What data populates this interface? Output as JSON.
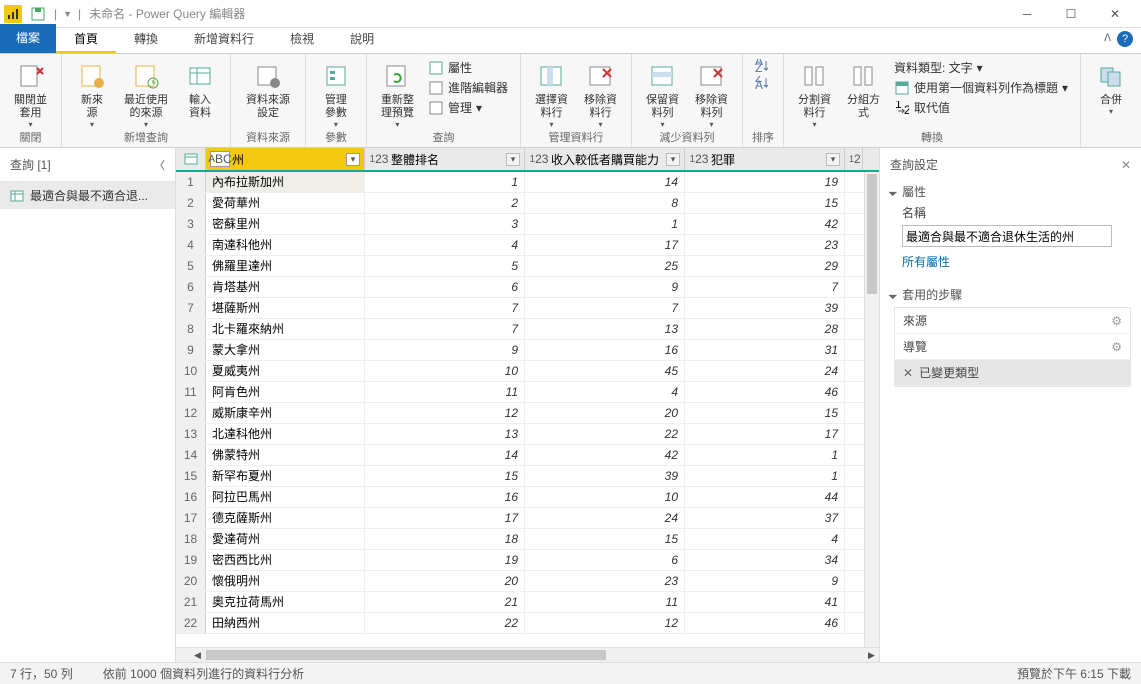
{
  "window": {
    "title": "未命名 - Power Query 編輯器"
  },
  "tabs": {
    "file": "檔案",
    "home": "首頁",
    "transform": "轉換",
    "addcol": "新增資料行",
    "view": "檢視",
    "help": "說明"
  },
  "ribbon": {
    "close": {
      "close_apply": "關閉並\n套用",
      "group": "關閉"
    },
    "newquery": {
      "new_source": "新來\n源",
      "recent": "最近使用\n的來源",
      "enter": "輸入\n資料",
      "group": "新增查詢"
    },
    "datasource": {
      "settings": "資料來源設定",
      "group": "資料來源"
    },
    "params": {
      "manage": "管理參數",
      "group": "參數"
    },
    "query": {
      "refresh": "重新整\n理預覽",
      "properties": "屬性",
      "adv_editor": "進階編輯器",
      "manage": "管理",
      "group": "查詢"
    },
    "cols": {
      "choose": "選擇資\n料行",
      "remove": "移除資\n料行",
      "group": "管理資料行"
    },
    "rows": {
      "keep": "保留資\n料列",
      "remove": "移除資\n料列",
      "group": "減少資料列"
    },
    "sort": {
      "group": "排序"
    },
    "split": {
      "split": "分割資\n料行",
      "groupby": "分組方\n式"
    },
    "transform": {
      "datatype": "資料類型: 文字",
      "first_row": "使用第一個資料列作為標題",
      "replace": "取代值",
      "group": "轉換"
    },
    "combine": {
      "combine": "合併",
      "group": ""
    }
  },
  "queries": {
    "header": "查詢 [1]",
    "items": [
      "最適合與最不適合退..."
    ]
  },
  "columns": [
    "州",
    "整體排名",
    "收入較低者購買能力",
    "犯罪"
  ],
  "rows": [
    {
      "n": 1,
      "state": "內布拉斯加州",
      "v": [
        1,
        14,
        19
      ]
    },
    {
      "n": 2,
      "state": "愛荷華州",
      "v": [
        2,
        8,
        15
      ]
    },
    {
      "n": 3,
      "state": "密蘇里州",
      "v": [
        3,
        1,
        42
      ]
    },
    {
      "n": 4,
      "state": "南達科他州",
      "v": [
        4,
        17,
        23
      ]
    },
    {
      "n": 5,
      "state": "佛羅里達州",
      "v": [
        5,
        25,
        29
      ]
    },
    {
      "n": 6,
      "state": "肯塔基州",
      "v": [
        6,
        9,
        7
      ]
    },
    {
      "n": 7,
      "state": "堪薩斯州",
      "v": [
        7,
        7,
        39
      ]
    },
    {
      "n": 8,
      "state": "北卡羅來納州",
      "v": [
        7,
        13,
        28
      ]
    },
    {
      "n": 9,
      "state": "蒙大拿州",
      "v": [
        9,
        16,
        31
      ]
    },
    {
      "n": 10,
      "state": "夏威夷州",
      "v": [
        10,
        45,
        24
      ]
    },
    {
      "n": 11,
      "state": "阿肯色州",
      "v": [
        11,
        4,
        46
      ]
    },
    {
      "n": 12,
      "state": "威斯康辛州",
      "v": [
        12,
        20,
        15
      ]
    },
    {
      "n": 13,
      "state": "北達科他州",
      "v": [
        13,
        22,
        17
      ]
    },
    {
      "n": 14,
      "state": "佛蒙特州",
      "v": [
        14,
        42,
        1
      ]
    },
    {
      "n": 15,
      "state": "新罕布夏州",
      "v": [
        15,
        39,
        1
      ]
    },
    {
      "n": 16,
      "state": "阿拉巴馬州",
      "v": [
        16,
        10,
        44
      ]
    },
    {
      "n": 17,
      "state": "德克薩斯州",
      "v": [
        17,
        24,
        37
      ]
    },
    {
      "n": 18,
      "state": "愛達荷州",
      "v": [
        18,
        15,
        4
      ]
    },
    {
      "n": 19,
      "state": "密西西比州",
      "v": [
        19,
        6,
        34
      ]
    },
    {
      "n": 20,
      "state": "懷俄明州",
      "v": [
        20,
        23,
        9
      ]
    },
    {
      "n": 21,
      "state": "奧克拉荷馬州",
      "v": [
        21,
        11,
        41
      ]
    },
    {
      "n": 22,
      "state": "田納西州",
      "v": [
        22,
        12,
        46
      ]
    }
  ],
  "settings": {
    "header": "查詢設定",
    "properties": "屬性",
    "name_label": "名稱",
    "name_value": "最適合與最不適合退休生活的州",
    "all_props": "所有屬性",
    "steps_header": "套用的步驟",
    "steps": [
      "來源",
      "導覽",
      "已變更類型"
    ]
  },
  "status": {
    "left": "7 行，50 列",
    "mid": "依前 1000 個資料列進行的資料行分析",
    "right": "預覽於下午 6:15 下載"
  }
}
